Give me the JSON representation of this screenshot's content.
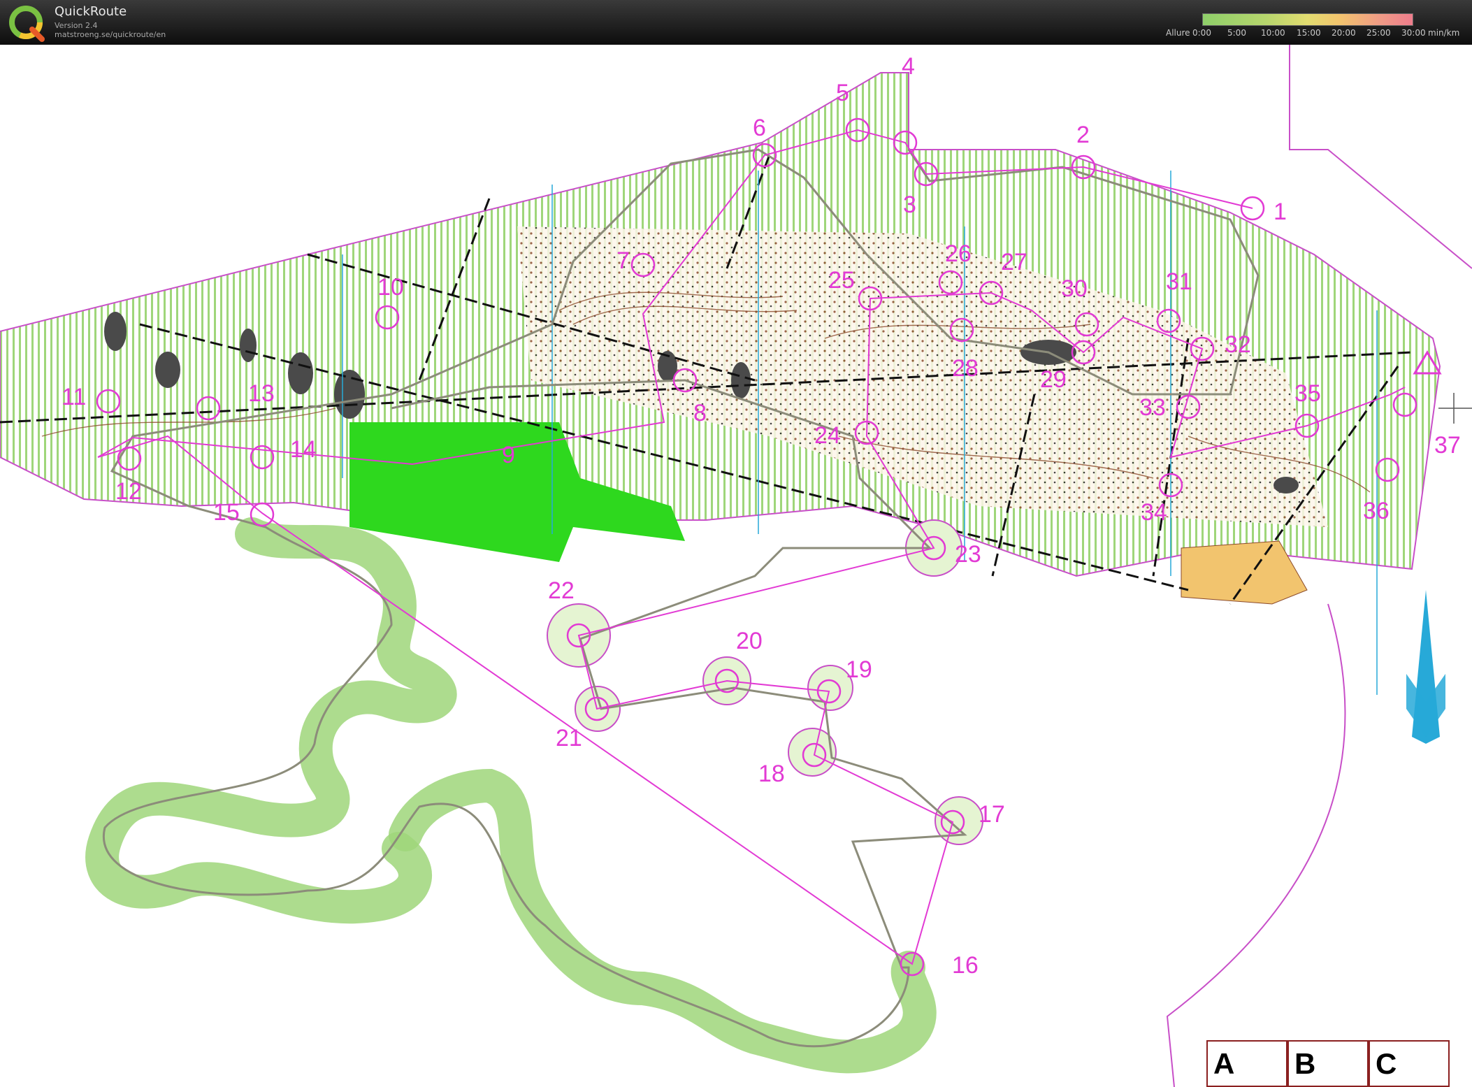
{
  "app": {
    "title": "QuickRoute",
    "version": "Version 2.4",
    "url": "matstroeng.se/quickroute/en"
  },
  "pace_legend": {
    "title": "Allure",
    "ticks": [
      "0:00",
      "5:00",
      "10:00",
      "15:00",
      "20:00",
      "25:00",
      "30:00"
    ],
    "unit": "min/km"
  },
  "map": {
    "controls": [
      "1",
      "2",
      "3",
      "4",
      "5",
      "6",
      "7",
      "8",
      "9",
      "10",
      "11",
      "12",
      "13",
      "14",
      "15",
      "16",
      "17",
      "18",
      "19",
      "20",
      "21",
      "22",
      "23",
      "24",
      "25",
      "26",
      "27",
      "28",
      "29",
      "30",
      "31",
      "32",
      "33",
      "34",
      "35",
      "36",
      "37"
    ],
    "colors": {
      "course": "#e23ad4",
      "route": "#8c8c7a",
      "open_land": "#2ed81e",
      "forest": "#ffffff",
      "vegetation": "#9fd67a",
      "contours": "#8b4a2a",
      "north_arrow": "#27a9d8"
    }
  },
  "boxes": [
    "A",
    "B",
    "C"
  ]
}
